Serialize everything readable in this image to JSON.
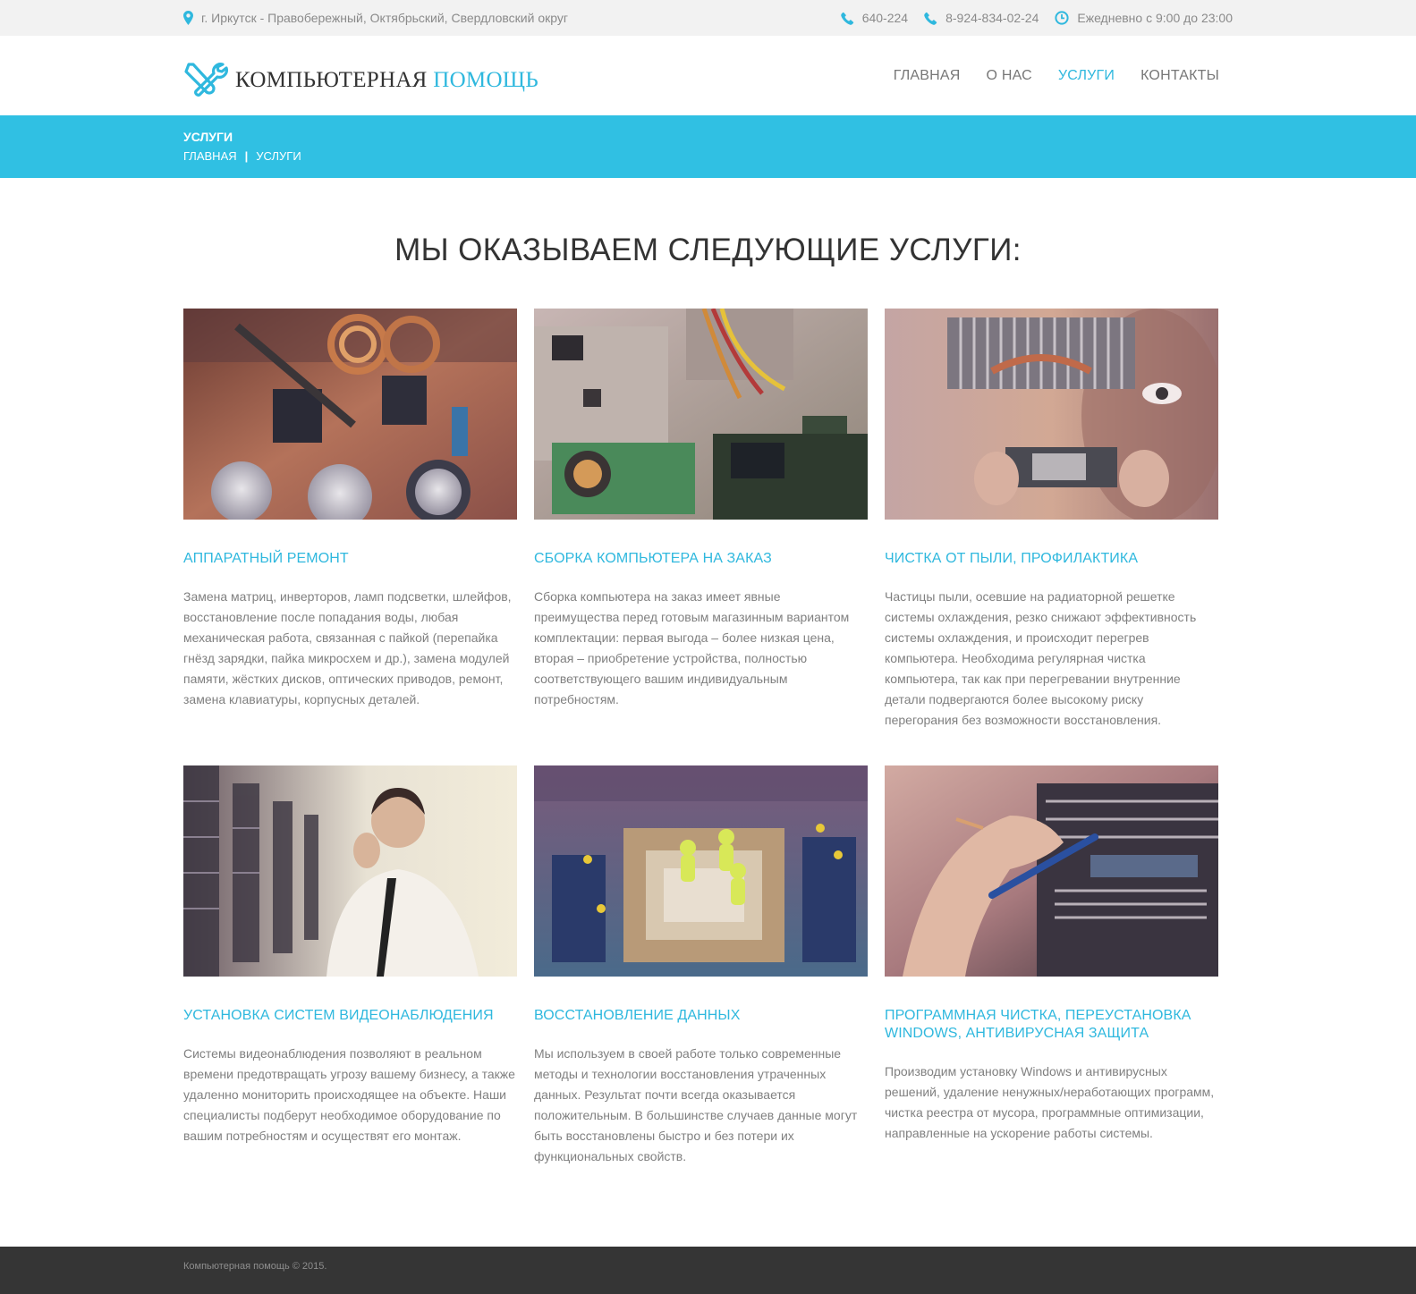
{
  "topbar": {
    "address": "г. Иркутск - Правобережный, Октябрьский, Свердловский округ",
    "phone1": "640-224",
    "phone2": "8-924-834-02-24",
    "hours": "Ежедневно с 9:00 до 23:00",
    "icons": [
      "map-pin-icon",
      "phone-icon",
      "phone-icon",
      "clock-icon"
    ]
  },
  "logo": {
    "text_main": "КОМПЬЮТЕРНАЯ",
    "text_accent": "ПОМОЩЬ",
    "icon": "wrench-screwdriver-icon"
  },
  "nav": [
    {
      "label": "ГЛАВНАЯ",
      "active": false
    },
    {
      "label": "О НАС",
      "active": false
    },
    {
      "label": "УСЛУГИ",
      "active": true
    },
    {
      "label": "КОНТАКТЫ",
      "active": false
    }
  ],
  "page_band": {
    "title": "УСЛУГИ",
    "breadcrumb_home": "ГЛАВНАЯ",
    "breadcrumb_sep": "|",
    "breadcrumb_current": "УСЛУГИ"
  },
  "section_title": "МЫ ОКАЗЫВАЕМ СЛЕДУЮЩИЕ УСЛУГИ:",
  "services": [
    {
      "title": "АППАРАТНЫЙ РЕМОНТ",
      "text": "Замена матриц, инверторов, ламп подсветки, шлейфов, восстановление после попадания воды, любая механическая работа, связанная с пайкой (перепайка гнёзд зарядки, пайка микросхем и др.), замена модулей памяти, жёстких дисков, оптических приводов, ремонт, замена клавиатуры, корпусных деталей."
    },
    {
      "title": "СБОРКА КОМПЬЮТЕРА НА ЗАКАЗ",
      "text": "Сборка компьютера на заказ имеет явные преимущества перед готовым магазинным вариантом комплектации: первая выгода – более низкая цена, вторая – приобретение устройства, полностью соответствующего вашим индивидуальным потребностям."
    },
    {
      "title": "ЧИСТКА ОТ ПЫЛИ, ПРОФИЛАКТИКА",
      "text": "Частицы пыли, осевшие на радиаторной решетке системы охлаждения, резко снижают эффективность системы охлаждения, и происходит перегрев компьютера. Необходима регулярная чистка компьютера, так как при перегревании внутренние детали подвергаются более высокому риску перегорания без возможности восстановления."
    },
    {
      "title": "УСТАНОВКА СИСТЕМ ВИДЕОНАБЛЮДЕНИЯ",
      "text": "Системы видеонаблюдения позволяют в реальном времени предотвращать угрозу вашему бизнесу, а также удаленно мониторить происходящее на объекте. Наши специалисты подберут необходимое оборудование по вашим потребностям и осуществят его монтаж."
    },
    {
      "title": "ВОССТАНОВЛЕНИЕ ДАННЫХ",
      "text": "Мы используем в своей работе только современные методы и технологии восстановления утраченных данных. Результат почти всегда оказывается положительным. В большинстве случаев данные могут быть восстановлены быстро и без потери их функциональных свойств."
    },
    {
      "title": "ПРОГРАММНАЯ ЧИСТКА, ПЕРЕУСТАНОВКА WINDOWS, АНТИВИРУСНАЯ ЗАЩИТА",
      "text": "Производим установку Windows и антивирусных решений, удаление ненужных/неработающих программ, чистка реестра от мусора, программные оптимизации, направленные на ускорение работы системы."
    }
  ],
  "footer": {
    "copyright": "Компьютерная помощь © 2015."
  },
  "colors": {
    "accent": "#2fb8de",
    "band": "#30c0e3",
    "footer": "#353535",
    "topbar": "#f2f2f2"
  }
}
